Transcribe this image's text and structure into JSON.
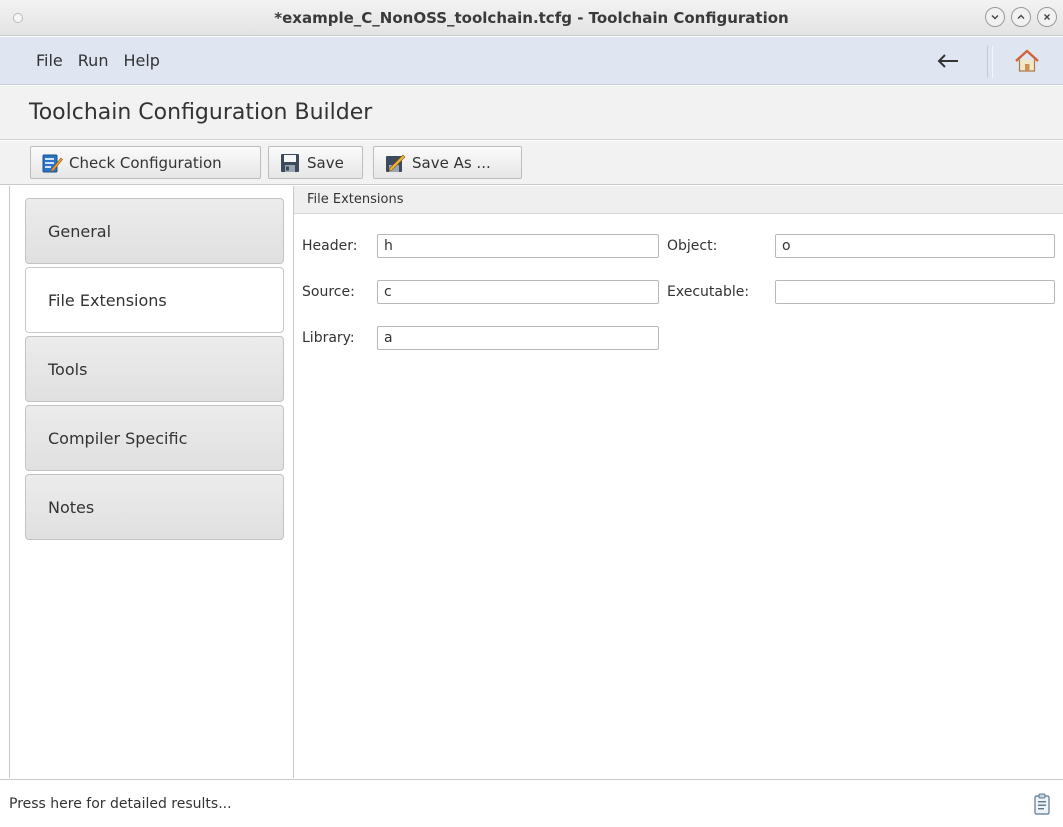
{
  "window": {
    "title": "*example_C_NonOSS_toolchain.tcfg - Toolchain Configuration",
    "buttons": [
      "minimize-icon",
      "maximize-icon",
      "close-icon"
    ]
  },
  "menubar": {
    "items": [
      "File",
      "Run",
      "Help"
    ],
    "back_icon": "arrow-left-icon",
    "home_icon": "home-icon"
  },
  "heading": "Toolchain Configuration Builder",
  "toolbar": {
    "check_label": "Check Configuration",
    "save_label": "Save",
    "save_as_label": "Save As ..."
  },
  "nav": {
    "items": [
      "General",
      "File Extensions",
      "Tools",
      "Compiler Specific",
      "Notes"
    ],
    "active": "File Extensions"
  },
  "section": {
    "title": "File Extensions",
    "header_label": "Header:",
    "header_value": "h",
    "source_label": "Source:",
    "source_value": "c",
    "library_label": "Library:",
    "library_value": "a",
    "object_label": "Object:",
    "object_value": "o",
    "executable_label": "Executable:",
    "executable_value": ""
  },
  "status": {
    "text": "Press here for detailed results...",
    "icon": "clipboard-icon"
  },
  "colors": {
    "menubar_bg": "#dfe6f1",
    "toolbar_bg": "#f2f2f2",
    "home_icon": "#d0633a"
  }
}
